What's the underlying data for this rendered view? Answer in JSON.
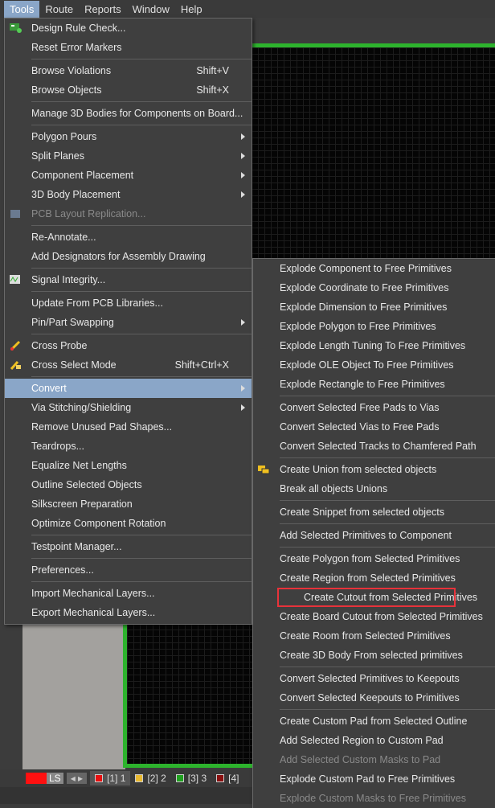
{
  "menubar": [
    "Tools",
    "Route",
    "Reports",
    "Window",
    "Help"
  ],
  "tools_menu": [
    {
      "label": "Design Rule Check...",
      "icon": "drc-icon"
    },
    {
      "label": "Reset Error Markers"
    },
    {
      "sep": true
    },
    {
      "label": "Browse Violations",
      "shortcut": "Shift+V"
    },
    {
      "label": "Browse Objects",
      "shortcut": "Shift+X"
    },
    {
      "sep": true
    },
    {
      "label": "Manage 3D Bodies for Components on Board..."
    },
    {
      "sep": true
    },
    {
      "label": "Polygon Pours",
      "submenu": true
    },
    {
      "label": "Split Planes",
      "submenu": true
    },
    {
      "label": "Component Placement",
      "submenu": true
    },
    {
      "label": "3D Body Placement",
      "submenu": true
    },
    {
      "label": "PCB Layout Replication...",
      "disabled": true,
      "icon": "replication-icon"
    },
    {
      "sep": true
    },
    {
      "label": "Re-Annotate..."
    },
    {
      "label": "Add Designators for Assembly Drawing"
    },
    {
      "sep": true
    },
    {
      "label": "Signal Integrity...",
      "icon": "signal-integrity-icon"
    },
    {
      "sep": true
    },
    {
      "label": "Update From PCB Libraries..."
    },
    {
      "label": "Pin/Part Swapping",
      "submenu": true
    },
    {
      "sep": true
    },
    {
      "label": "Cross Probe",
      "icon": "cross-probe-icon"
    },
    {
      "label": "Cross Select Mode",
      "shortcut": "Shift+Ctrl+X",
      "icon": "cross-select-icon"
    },
    {
      "sep": true
    },
    {
      "label": "Convert",
      "submenu": true,
      "highlighted": true
    },
    {
      "label": "Via Stitching/Shielding",
      "submenu": true
    },
    {
      "label": "Remove Unused Pad Shapes..."
    },
    {
      "label": "Teardrops..."
    },
    {
      "label": "Equalize Net Lengths"
    },
    {
      "label": "Outline Selected Objects"
    },
    {
      "label": "Silkscreen Preparation"
    },
    {
      "label": "Optimize Component Rotation"
    },
    {
      "sep": true
    },
    {
      "label": "Testpoint Manager..."
    },
    {
      "sep": true
    },
    {
      "label": "Preferences..."
    },
    {
      "sep": true
    },
    {
      "label": "Import Mechanical Layers..."
    },
    {
      "label": "Export Mechanical Layers..."
    }
  ],
  "convert_submenu": [
    {
      "label": "Explode Component to Free Primitives"
    },
    {
      "label": "Explode Coordinate to Free Primitives"
    },
    {
      "label": "Explode Dimension to Free Primitives"
    },
    {
      "label": "Explode Polygon to Free Primitives"
    },
    {
      "label": "Explode Length Tuning To Free Primitives"
    },
    {
      "label": "Explode OLE Object To Free Primitives"
    },
    {
      "label": "Explode Rectangle to Free Primitives"
    },
    {
      "sep": true
    },
    {
      "label": "Convert Selected Free Pads to Vias"
    },
    {
      "label": "Convert Selected Vias to Free Pads"
    },
    {
      "label": "Convert Selected Tracks to Chamfered Path"
    },
    {
      "sep": true
    },
    {
      "label": "Create Union from selected objects",
      "icon": "union-icon"
    },
    {
      "label": "Break all objects Unions"
    },
    {
      "sep": true
    },
    {
      "label": "Create Snippet from selected objects"
    },
    {
      "sep": true
    },
    {
      "label": "Add Selected Primitives to Component"
    },
    {
      "sep": true
    },
    {
      "label": "Create Polygon from Selected Primitives"
    },
    {
      "label": "Create Region from Selected Primitives"
    },
    {
      "label": "Create Cutout from Selected Primitives",
      "boxed": true
    },
    {
      "label": "Create Board Cutout from Selected Primitives"
    },
    {
      "label": "Create Room from Selected Primitives"
    },
    {
      "label": "Create 3D Body From selected primitives"
    },
    {
      "sep": true
    },
    {
      "label": "Convert Selected Primitives to Keepouts"
    },
    {
      "label": "Convert Selected Keepouts to Primitives"
    },
    {
      "sep": true
    },
    {
      "label": "Create Custom Pad from Selected Outline"
    },
    {
      "label": "Add Selected Region to Custom Pad"
    },
    {
      "label": "Add Selected Custom Masks to Pad",
      "disabled": true
    },
    {
      "label": "Explode Custom Pad to Free Primitives"
    },
    {
      "label": "Explode Custom Masks to Free Primitives",
      "disabled": true
    }
  ],
  "layer_tabs": {
    "ls": "LS",
    "tabs": [
      {
        "label": "[1] 1",
        "color": "#e81010"
      },
      {
        "label": "[2] 2",
        "color": "#e8b830"
      },
      {
        "label": "[3] 3",
        "color": "#20a020"
      },
      {
        "label": "[4]",
        "color": "#8a1010"
      }
    ]
  }
}
